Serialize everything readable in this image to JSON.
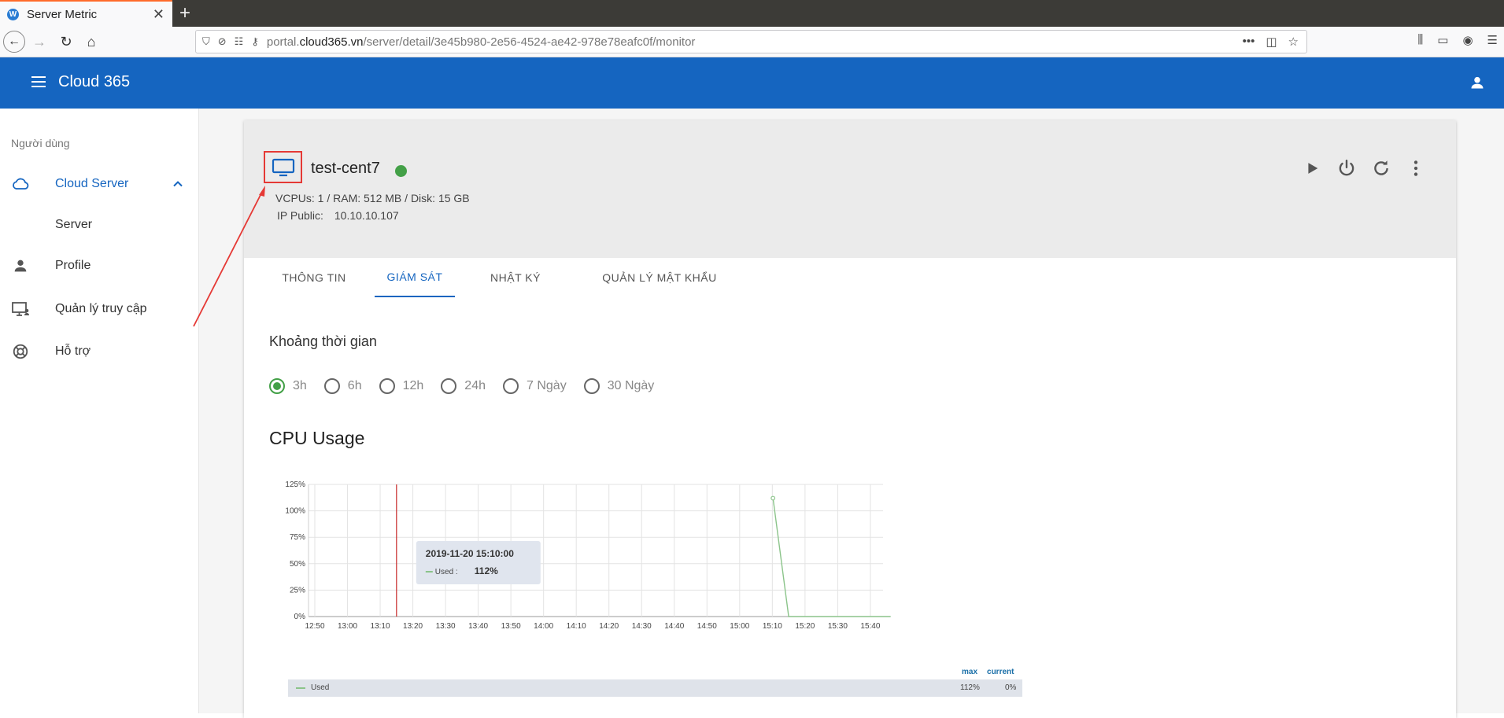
{
  "browser": {
    "tab_title": "Server Metric",
    "url_prefix": "portal.",
    "url_domain": "cloud365.vn",
    "url_path": "/server/detail/3e45b980-2e56-4524-ae42-978e78eafc0f/monitor"
  },
  "app": {
    "title": "Cloud 365"
  },
  "sidebar": {
    "section": "Người dùng",
    "items": [
      {
        "label": "Cloud Server",
        "icon": "cloud-icon"
      },
      {
        "label": "Server",
        "icon": ""
      },
      {
        "label": "Profile",
        "icon": "person-icon"
      },
      {
        "label": "Quản lý truy cập",
        "icon": "access-icon"
      },
      {
        "label": "Hỗ trợ",
        "icon": "support-icon"
      }
    ]
  },
  "server": {
    "name": "test-cent7",
    "status_color": "#43a047",
    "specs": "VCPUs: 1 / RAM: 512 MB / Disk: 15 GB",
    "ip_label": "IP Public:",
    "ip_value": "10.10.10.107"
  },
  "tabs": [
    "THÔNG TIN",
    "GIÁM SÁT",
    "NHẬT KÝ",
    "QUẢN LÝ MẬT KHẨU"
  ],
  "period": {
    "title": "Khoảng thời gian",
    "options": [
      "3h",
      "6h",
      "12h",
      "24h",
      "7 Ngày",
      "30 Ngày"
    ],
    "selected": "3h"
  },
  "chart_title": "CPU Usage",
  "tooltip": {
    "time": "2019-11-20 15:10:00",
    "series_label": "Used :",
    "value": "112%"
  },
  "legend": {
    "max_header": "max",
    "current_header": "current",
    "series_name": "Used",
    "max_value": "112%",
    "current_value": "0%"
  },
  "colors": {
    "brand": "#1565c0",
    "series": "#8bc48a",
    "cursor": "#c62828"
  },
  "chart_data": {
    "type": "line",
    "title": "CPU Usage",
    "x": [
      "12:50",
      "13:00",
      "13:10",
      "13:20",
      "13:30",
      "13:40",
      "13:50",
      "14:00",
      "14:10",
      "14:20",
      "14:30",
      "14:40",
      "14:50",
      "15:00",
      "15:10",
      "15:20",
      "15:30",
      "15:40"
    ],
    "ytick_labels": [
      "0%",
      "25%",
      "50%",
      "75%",
      "100%",
      "125%"
    ],
    "ylim": [
      0,
      125
    ],
    "grid": true,
    "series": [
      {
        "name": "Used",
        "points": [
          [
            15.17,
            112
          ],
          [
            15.25,
            0
          ],
          [
            15.47,
            0
          ],
          [
            15.77,
            0
          ]
        ]
      }
    ],
    "cursor_x": "13:15"
  }
}
